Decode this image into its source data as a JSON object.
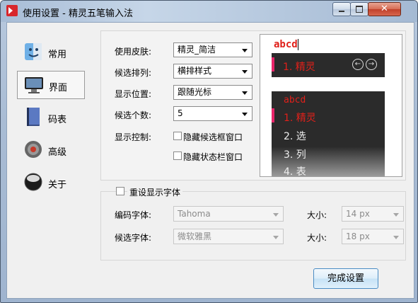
{
  "window": {
    "title": "使用设置 - 精灵五笔输入法"
  },
  "nav": {
    "items": [
      {
        "label": "常用"
      },
      {
        "label": "界面"
      },
      {
        "label": "码表"
      },
      {
        "label": "高级"
      },
      {
        "label": "关于"
      }
    ]
  },
  "settings": {
    "skin": {
      "label": "使用皮肤:",
      "value": "精灵_简洁"
    },
    "layout": {
      "label": "候选排列:",
      "value": "横排样式"
    },
    "position": {
      "label": "显示位置:",
      "value": "跟随光标"
    },
    "count": {
      "label": "候选个数:",
      "value": "5"
    },
    "display_control": {
      "label": "显示控制:"
    },
    "hide_candidate": {
      "label": "隐藏候选框窗口"
    },
    "hide_status": {
      "label": "隐藏状态栏窗口"
    }
  },
  "preview": {
    "h_code": "abcd",
    "h_candidate": "1. 精灵",
    "v_code": "abcd",
    "v_items": [
      "1. 精灵",
      "2. 选",
      "3. 列",
      "4. 表"
    ]
  },
  "font_group": {
    "toggle_label": "重设显示字体",
    "code_font": {
      "label": "编码字体:",
      "value": "Tahoma",
      "size_label": "大小:",
      "size": "14 px"
    },
    "cand_font": {
      "label": "候选字体:",
      "value": "微软雅黑",
      "size_label": "大小:",
      "size": "18 px"
    }
  },
  "done_label": "完成设置"
}
